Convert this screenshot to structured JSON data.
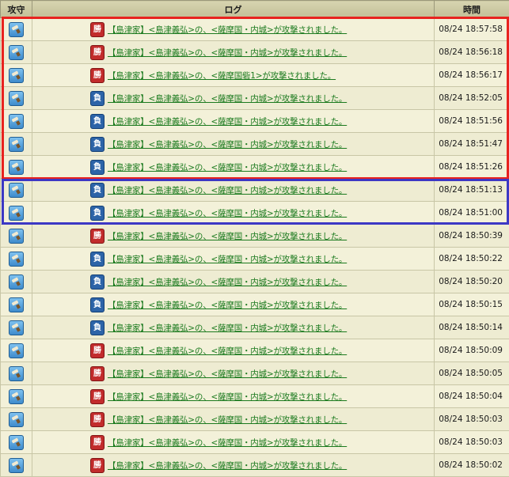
{
  "header": {
    "col_attack": "攻守",
    "col_log": "ログ",
    "col_time": "時間"
  },
  "rows": [
    {
      "result": "勝",
      "outcome": "win",
      "message": "【島津家】<島津義弘>の、<薩摩国・内城>が攻撃されました。",
      "time": "08/24 18:57:58"
    },
    {
      "result": "勝",
      "outcome": "win",
      "message": "【島津家】<島津義弘>の、<薩摩国・内城>が攻撃されました。",
      "time": "08/24 18:56:18"
    },
    {
      "result": "勝",
      "outcome": "win",
      "message": "【島津家】<島津義弘>の、<薩摩国砦1>が攻撃されました。",
      "time": "08/24 18:56:17"
    },
    {
      "result": "負",
      "outcome": "lose",
      "message": "【島津家】<島津義弘>の、<薩摩国・内城>が攻撃されました。",
      "time": "08/24 18:52:05"
    },
    {
      "result": "負",
      "outcome": "lose",
      "message": "【島津家】<島津義弘>の、<薩摩国・内城>が攻撃されました。",
      "time": "08/24 18:51:56"
    },
    {
      "result": "負",
      "outcome": "lose",
      "message": "【島津家】<島津義弘>の、<薩摩国・内城>が攻撃されました。",
      "time": "08/24 18:51:47"
    },
    {
      "result": "負",
      "outcome": "lose",
      "message": "【島津家】<島津義弘>の、<薩摩国・内城>が攻撃されました。",
      "time": "08/24 18:51:26"
    },
    {
      "result": "負",
      "outcome": "lose",
      "message": "【島津家】<島津義弘>の、<薩摩国・内城>が攻撃されました。",
      "time": "08/24 18:51:13"
    },
    {
      "result": "負",
      "outcome": "lose",
      "message": "【島津家】<島津義弘>の、<薩摩国・内城>が攻撃されました。",
      "time": "08/24 18:51:00"
    },
    {
      "result": "勝",
      "outcome": "win",
      "message": "【島津家】<島津義弘>の、<薩摩国・内城>が攻撃されました。",
      "time": "08/24 18:50:39"
    },
    {
      "result": "負",
      "outcome": "lose",
      "message": "【島津家】<島津義弘>の、<薩摩国・内城>が攻撃されました。",
      "time": "08/24 18:50:22"
    },
    {
      "result": "負",
      "outcome": "lose",
      "message": "【島津家】<島津義弘>の、<薩摩国・内城>が攻撃されました。",
      "time": "08/24 18:50:20"
    },
    {
      "result": "負",
      "outcome": "lose",
      "message": "【島津家】<島津義弘>の、<薩摩国・内城>が攻撃されました。",
      "time": "08/24 18:50:15"
    },
    {
      "result": "負",
      "outcome": "lose",
      "message": "【島津家】<島津義弘>の、<薩摩国・内城>が攻撃されました。",
      "time": "08/24 18:50:14"
    },
    {
      "result": "勝",
      "outcome": "win",
      "message": "【島津家】<島津義弘>の、<薩摩国・内城>が攻撃されました。",
      "time": "08/24 18:50:09"
    },
    {
      "result": "勝",
      "outcome": "win",
      "message": "【島津家】<島津義弘>の、<薩摩国・内城>が攻撃されました。",
      "time": "08/24 18:50:05"
    },
    {
      "result": "勝",
      "outcome": "win",
      "message": "【島津家】<島津義弘>の、<薩摩国・内城>が攻撃されました。",
      "time": "08/24 18:50:04"
    },
    {
      "result": "勝",
      "outcome": "win",
      "message": "【島津家】<島津義弘>の、<薩摩国・内城>が攻撃されました。",
      "time": "08/24 18:50:03"
    },
    {
      "result": "勝",
      "outcome": "win",
      "message": "【島津家】<島津義弘>の、<薩摩国・内城>が攻撃されました。",
      "time": "08/24 18:50:03"
    },
    {
      "result": "勝",
      "outcome": "win",
      "message": "【島津家】<島津義弘>の、<薩摩国・内城>が攻撃されました。",
      "time": "08/24 18:50:02"
    }
  ],
  "icons": {
    "row_icon": "attack-icon"
  },
  "colors": {
    "win": "#c22c2c",
    "lose": "#2d64a8",
    "link": "#1b7a1e",
    "highlight_red": "#e8231f",
    "highlight_blue": "#3c38c4"
  }
}
